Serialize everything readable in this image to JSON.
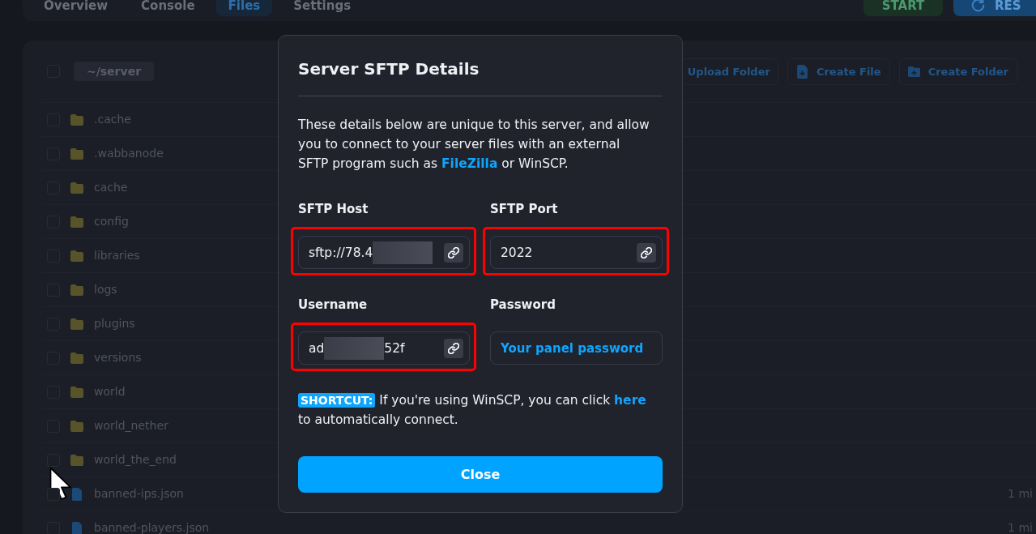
{
  "app": {
    "tabs": [
      {
        "label": "Overview",
        "selected": false
      },
      {
        "label": "Console",
        "selected": false
      },
      {
        "label": "Files",
        "selected": true
      },
      {
        "label": "Settings",
        "selected": false
      }
    ],
    "power_buttons": [
      {
        "label": "START",
        "kind": "start"
      },
      {
        "label": "RES",
        "kind": "restart"
      }
    ],
    "path": {
      "label": "~/server",
      "checked": false
    },
    "toolbar": [
      {
        "label": "Upload Folder",
        "kind": "upload-folder"
      },
      {
        "label": "Create File",
        "kind": "create-file"
      },
      {
        "label": "Create Folder",
        "kind": "create-folder"
      }
    ],
    "files": [
      {
        "name": ".cache",
        "kind": "folder",
        "checked": false
      },
      {
        "name": ".wabbanode",
        "kind": "folder",
        "checked": false
      },
      {
        "name": "cache",
        "kind": "folder",
        "checked": false
      },
      {
        "name": "config",
        "kind": "folder",
        "checked": false
      },
      {
        "name": "libraries",
        "kind": "folder",
        "checked": false
      },
      {
        "name": "logs",
        "kind": "folder",
        "checked": false
      },
      {
        "name": "plugins",
        "kind": "folder",
        "checked": false
      },
      {
        "name": "versions",
        "kind": "folder",
        "checked": false
      },
      {
        "name": "world",
        "kind": "folder",
        "checked": false
      },
      {
        "name": "world_nether",
        "kind": "folder",
        "checked": false
      },
      {
        "name": "world_the_end",
        "kind": "folder",
        "checked": false
      },
      {
        "name": "banned-ips.json",
        "kind": "file",
        "checked": false,
        "modified": "1 mi"
      },
      {
        "name": "banned-players.json",
        "kind": "file",
        "checked": false,
        "modified": "1 mi"
      }
    ]
  },
  "dialog": {
    "title": "Server SFTP Details",
    "intro": {
      "text": "These details below are unique to this server, and allow\nyou to connect to your server files with an external\nSFTP program such as",
      "link": "FileZilla",
      "text_after": "or WinSCP."
    },
    "fields": [
      {
        "label": "SFTP Host",
        "kind": "copyable",
        "value": "sftp://78.4",
        "redacted": true,
        "highlighted": true
      },
      {
        "label": "SFTP Port",
        "kind": "copyable",
        "value": "2022",
        "redacted": false,
        "highlighted": true
      },
      {
        "label": "Username",
        "kind": "copyable",
        "value": "ad",
        "value_after": "52f",
        "redacted": true,
        "highlighted": true
      },
      {
        "label": "Password",
        "kind": "link",
        "value": "Your panel password",
        "redacted": false,
        "highlighted": false
      }
    ],
    "shortcut": {
      "badge": "SHORTCUT:",
      "text": "If you're using WinSCP, you can click",
      "link": "here",
      "text_after": "\nto automatically connect."
    },
    "close_button": "Close"
  }
}
